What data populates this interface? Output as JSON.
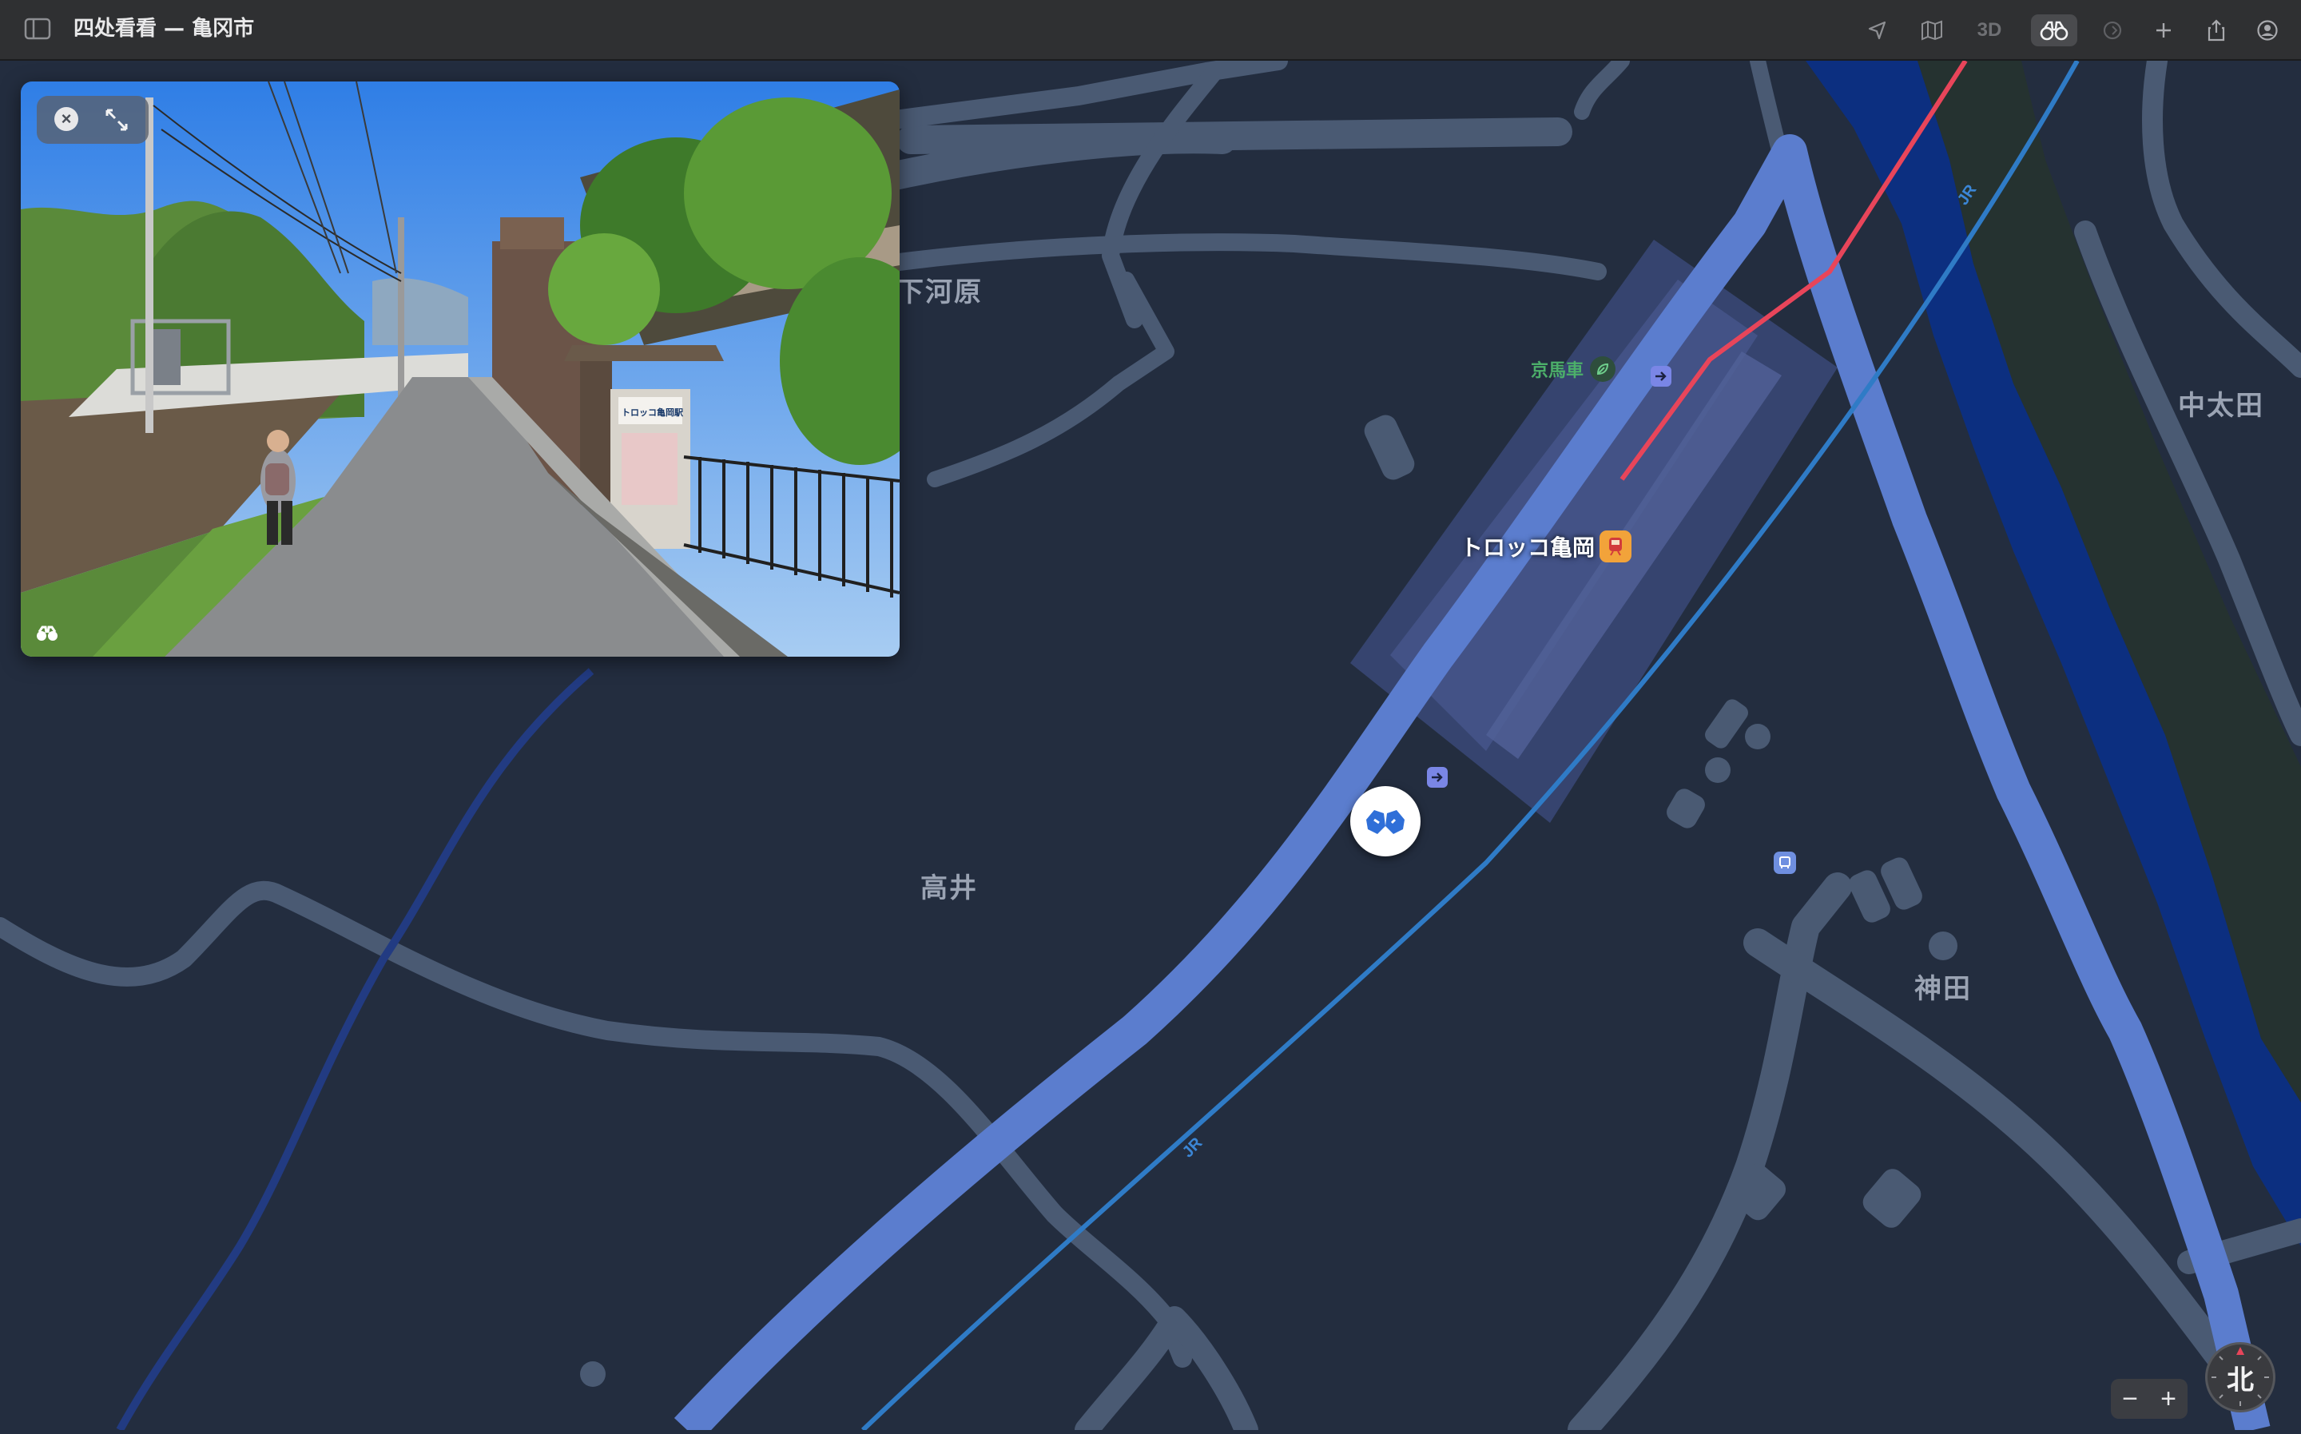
{
  "window": {
    "title": "四处看看 — 亀冈市"
  },
  "toolbar": {
    "icons": [
      "sidebar-icon",
      "location-arrow-icon",
      "map-icon",
      "3d-toggle",
      "binoculars-icon",
      "look-around-icon",
      "plus-icon",
      "share-icon",
      "account-icon"
    ],
    "three_d_label": "3D"
  },
  "map": {
    "places": {
      "shimogawara": "下河原",
      "nakatata": "中太田",
      "takai": "高井",
      "kanda": "神田"
    },
    "pois": {
      "station_name": "トロッコ亀岡",
      "kyobasha": "京馬車"
    },
    "rail_labels": [
      "JR",
      "JR"
    ],
    "colors": {
      "background": "#232d3f",
      "road": "#4a5a73",
      "highway": "#5b7dce",
      "rail_jr": "#2f7bc6",
      "rail_torokko": "#e8455a",
      "river": "#0c2f80"
    }
  },
  "look_around": {
    "sign_text": "トロッコ亀岡駅"
  },
  "controls": {
    "zoom_out": "−",
    "zoom_in": "+",
    "compass_label": "北"
  }
}
